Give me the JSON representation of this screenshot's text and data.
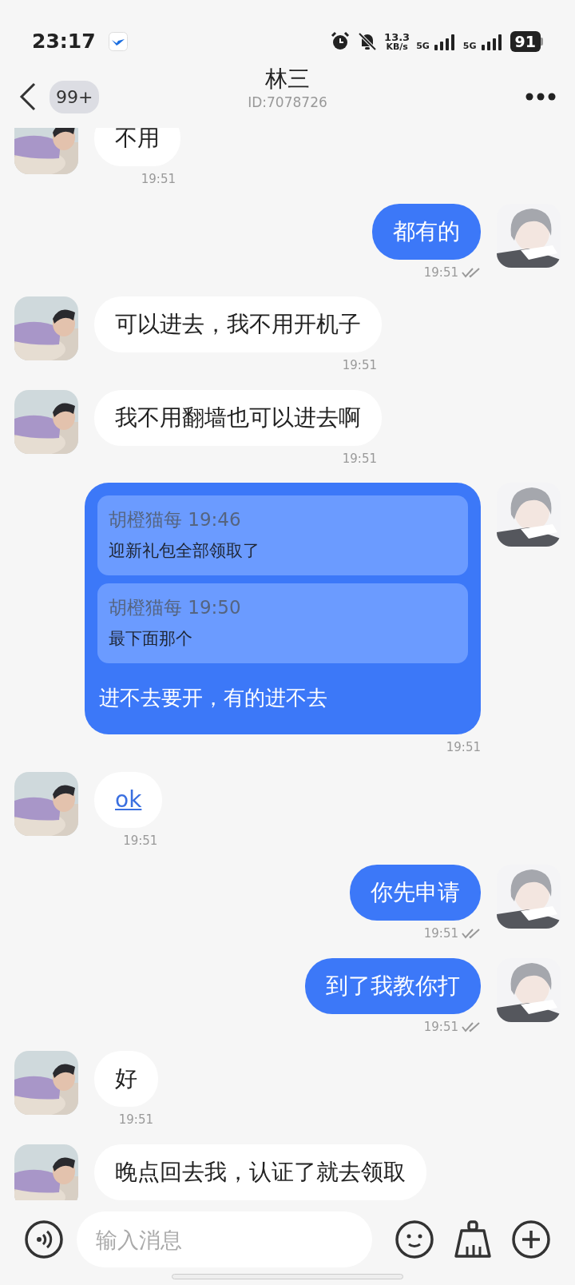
{
  "status_bar": {
    "time": "23:17",
    "net_speed": "13.3",
    "net_unit": "KB/s",
    "networks": [
      {
        "label": "5G"
      },
      {
        "label": "5G"
      }
    ],
    "battery": "91"
  },
  "header": {
    "unread_badge": "99+",
    "title": "林三",
    "subtitle": "ID:7078726"
  },
  "messages": [
    {
      "outgoing": false,
      "kind": "text",
      "text": "不用",
      "time": "19:51"
    },
    {
      "outgoing": true,
      "kind": "text",
      "text": "都有的",
      "time": "19:51",
      "read": true
    },
    {
      "outgoing": false,
      "kind": "text",
      "text": "可以进去，我不用开机子",
      "time": "19:51"
    },
    {
      "outgoing": false,
      "kind": "text",
      "text": "我不用翻墙也可以进去啊",
      "time": "19:51"
    },
    {
      "outgoing": true,
      "kind": "quote",
      "quotes": [
        {
          "author": "胡橙猫每",
          "time": "19:46",
          "text": "迎新礼包全部领取了"
        },
        {
          "author": "胡橙猫每",
          "time": "19:50",
          "text": "最下面那个"
        }
      ],
      "text": "进不去要开，有的进不去",
      "time": "19:51",
      "read": false
    },
    {
      "outgoing": false,
      "kind": "link",
      "text": "ok",
      "time": "19:51"
    },
    {
      "outgoing": true,
      "kind": "text",
      "text": "你先申请",
      "time": "19:51",
      "read": true
    },
    {
      "outgoing": true,
      "kind": "text",
      "text": "到了我教你打",
      "time": "19:51",
      "read": true
    },
    {
      "outgoing": false,
      "kind": "text",
      "text": "好",
      "time": "19:51"
    },
    {
      "outgoing": false,
      "kind": "text",
      "text": "晚点回去我，认证了就去领取"
    }
  ],
  "composer": {
    "placeholder": "输入消息"
  }
}
